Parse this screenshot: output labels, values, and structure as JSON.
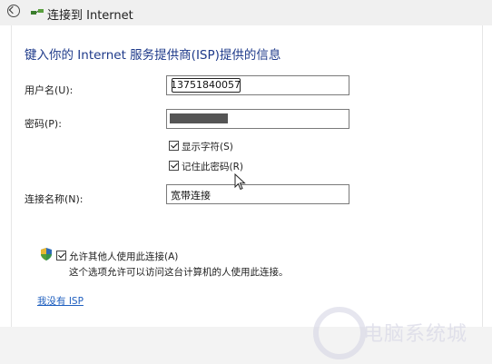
{
  "window": {
    "title": "连接到 Internet"
  },
  "page": {
    "heading": "键入你的 Internet 服务提供商(ISP)提供的信息"
  },
  "form": {
    "username_label": "用户名(U):",
    "username_value": "13751840057",
    "password_label": "密码(P):",
    "show_chars_label": "显示字符(S)",
    "show_chars_checked": true,
    "remember_password_label": "记住此密码(R)",
    "remember_password_checked": true,
    "connection_name_label": "连接名称(N):",
    "connection_name_value": "宽带连接"
  },
  "sharing": {
    "allow_others_label": "允许其他人使用此连接(A)",
    "allow_others_checked": true,
    "allow_others_desc": "这个选项允许可以访问这台计算机的人使用此连接。"
  },
  "links": {
    "no_isp": "我没有 ISP"
  },
  "watermark": {
    "text": "电脑系统城"
  },
  "colors": {
    "heading": "#1e3a8a",
    "link": "#1f5fbf"
  }
}
